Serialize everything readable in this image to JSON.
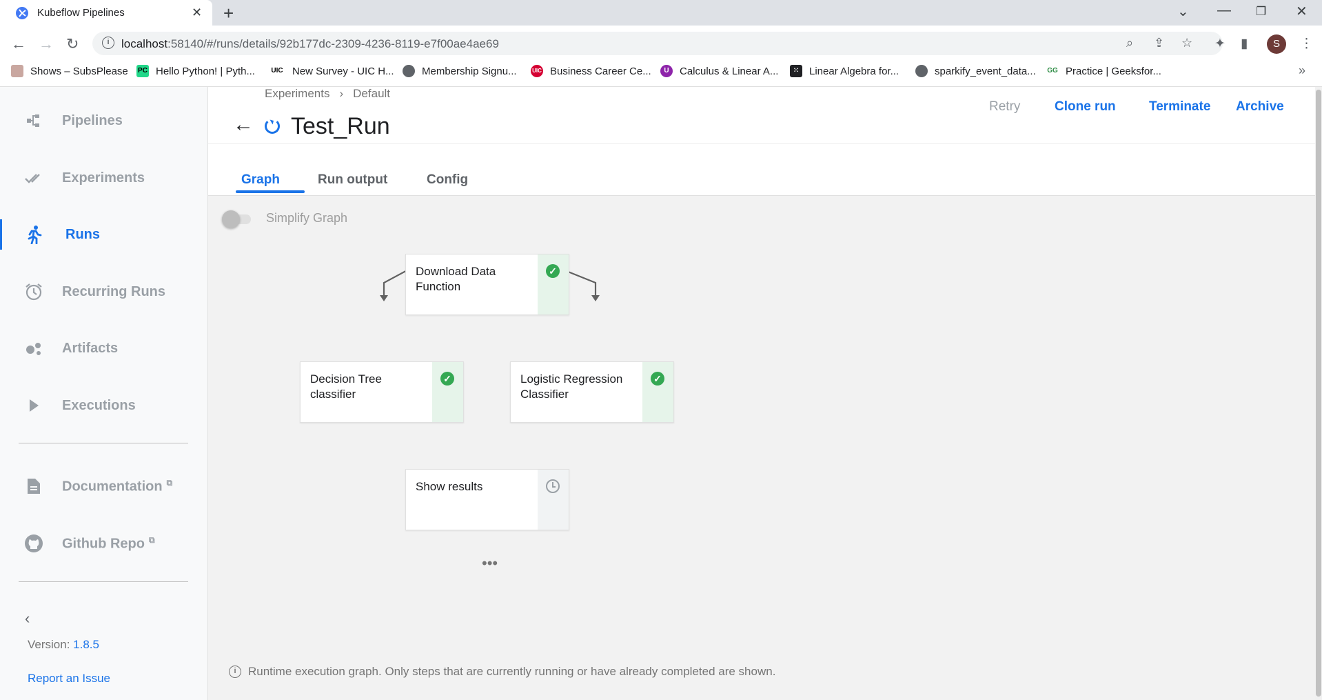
{
  "browser": {
    "tab_title": "Kubeflow Pipelines",
    "url_host": "localhost",
    "url_rest": ":58140/#/runs/details/92b177dc-2309-4236-8119-e7f00ae4ae69",
    "profile_initial": "S",
    "bookmarks": [
      {
        "label": "Shows – SubsPlease",
        "icon": "subsplease-icon"
      },
      {
        "label": "Hello Python! | Pyth...",
        "icon": "pycharm-icon"
      },
      {
        "label": "New Survey - UIC H...",
        "icon": "uic-icon"
      },
      {
        "label": "Membership Signu...",
        "icon": "globe-icon"
      },
      {
        "label": "Business Career Ce...",
        "icon": "uic-red-icon"
      },
      {
        "label": "Calculus & Linear A...",
        "icon": "purple-icon"
      },
      {
        "label": "Linear Algebra for...",
        "icon": "dice-icon"
      },
      {
        "label": "sparkify_event_data...",
        "icon": "globe-icon"
      },
      {
        "label": "Practice | Geeksfor...",
        "icon": "gfg-icon"
      }
    ]
  },
  "sidebar": {
    "items": [
      {
        "label": "Pipelines",
        "icon": "pipeline-icon"
      },
      {
        "label": "Experiments",
        "icon": "double-check-icon"
      },
      {
        "label": "Runs",
        "icon": "run-icon"
      },
      {
        "label": "Recurring Runs",
        "icon": "alarm-icon"
      },
      {
        "label": "Artifacts",
        "icon": "bubbles-icon"
      },
      {
        "label": "Executions",
        "icon": "play-icon"
      }
    ],
    "links": [
      {
        "label": "Documentation",
        "icon": "document-icon"
      },
      {
        "label": "Github Repo",
        "icon": "github-icon"
      }
    ],
    "version_label": "Version:",
    "version_value": "1.8.5",
    "report_label": "Report an Issue"
  },
  "header": {
    "breadcrumb": [
      "Experiments",
      "Default"
    ],
    "breadcrumb_sep": "›",
    "title": "Test_Run",
    "actions": {
      "retry": "Retry",
      "clone": "Clone run",
      "terminate": "Terminate",
      "archive": "Archive"
    }
  },
  "tabs": [
    "Graph",
    "Run output",
    "Config"
  ],
  "graph": {
    "simplify_label": "Simplify Graph",
    "nodes": [
      {
        "label": "Download Data Function",
        "status": "succeeded"
      },
      {
        "label": "Decision Tree classifier",
        "status": "succeeded"
      },
      {
        "label": "Logistic Regression Classifier",
        "status": "succeeded"
      },
      {
        "label": "Show results",
        "status": "pending"
      }
    ],
    "more": "•••",
    "footnote": "Runtime execution graph. Only steps that are currently running or have already completed are shown."
  },
  "colors": {
    "accent": "#1a73e8",
    "success": "#34a853",
    "muted": "#9aa0a6"
  }
}
